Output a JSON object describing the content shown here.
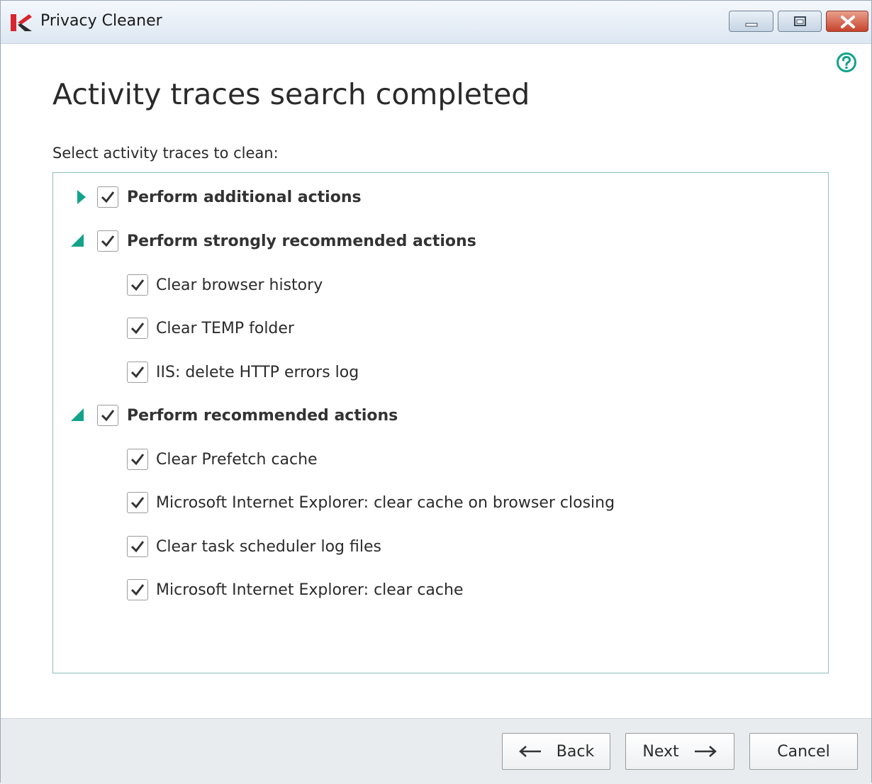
{
  "window": {
    "title": "Privacy Cleaner",
    "app_icon": "kaspersky-k-icon",
    "controls": [
      "minimize-icon",
      "maximize-icon",
      "close-icon"
    ]
  },
  "help_icon": "help-circle-icon",
  "page": {
    "heading": "Activity traces search completed",
    "subheading": "Select activity traces to clean:"
  },
  "groups": [
    {
      "label": "Perform additional actions",
      "checked": true,
      "expanded": false,
      "items": []
    },
    {
      "label": "Perform strongly recommended actions",
      "checked": true,
      "expanded": true,
      "items": [
        {
          "label": "Clear browser history",
          "checked": true
        },
        {
          "label": "Clear TEMP folder",
          "checked": true
        },
        {
          "label": "IIS: delete HTTP errors log",
          "checked": true
        }
      ]
    },
    {
      "label": "Perform recommended actions",
      "checked": true,
      "expanded": true,
      "items": [
        {
          "label": "Clear Prefetch cache",
          "checked": true
        },
        {
          "label": "Microsoft Internet Explorer: clear cache on browser closing",
          "checked": true
        },
        {
          "label": "Clear task scheduler log files",
          "checked": true
        },
        {
          "label": "Microsoft Internet Explorer: clear cache",
          "checked": true
        }
      ]
    }
  ],
  "buttons": {
    "back": "Back",
    "next": "Next",
    "cancel": "Cancel"
  },
  "colors": {
    "accent_teal": "#13a38b",
    "close_red": "#c7432b"
  }
}
